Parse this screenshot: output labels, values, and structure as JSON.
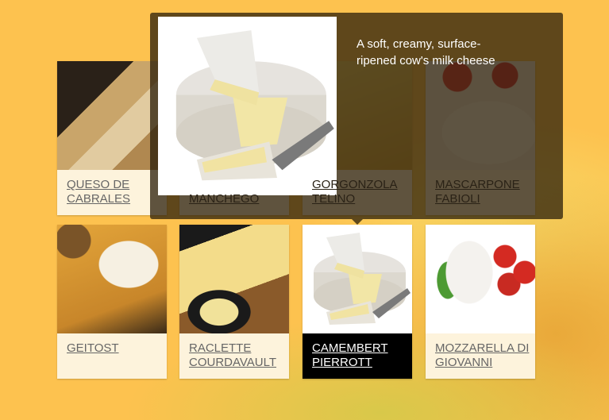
{
  "tooltip": {
    "description": "A soft, creamy, surface-ripened cow's milk cheese",
    "image": "camembert-photo"
  },
  "products": [
    {
      "line1": "QUESO DE",
      "line2": "CABRALES",
      "image": "cabrales-photo"
    },
    {
      "line1": "",
      "line2": "MANCHEGO",
      "image": "manchego-photo"
    },
    {
      "line1": "GORGONZOLA",
      "line2": "TELINO",
      "image": "gorgonzola-photo"
    },
    {
      "line1": "MASCARPONE",
      "line2": "FABIOLI",
      "image": "mascarpone-photo"
    },
    {
      "line1": "GEITOST",
      "line2": "",
      "image": "geitost-photo"
    },
    {
      "line1": "RACLETTE",
      "line2": "COURDAVAULT",
      "image": "raclette-photo"
    },
    {
      "line1": "CAMEMBERT",
      "line2": "PIERROTT",
      "image": "camembert-photo",
      "active": true
    },
    {
      "line1": "MOZZARELLA DI",
      "line2": "GIOVANNI",
      "image": "mozzarella-photo"
    }
  ],
  "colors": {
    "background": "#fdc24f",
    "card": "#fdf3dc",
    "active_card": "#000000",
    "tooltip": "#2a1e0a"
  }
}
